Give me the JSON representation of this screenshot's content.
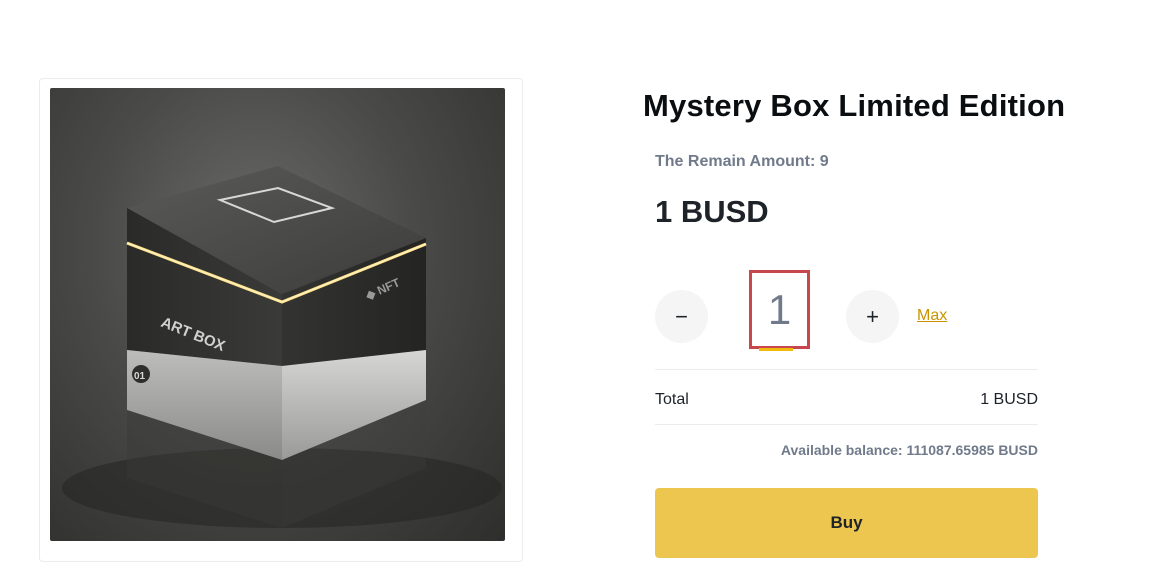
{
  "product": {
    "title": "Mystery Box Limited Edition",
    "remain_label": "The Remain Amount: 9",
    "price": "1 BUSD",
    "image_icon": "art-box-cube-image",
    "image_marks": {
      "brand": "ART BOX",
      "nft": "◆ NFT",
      "number": "01"
    }
  },
  "quantity": {
    "value": "1",
    "minus_symbol": "−",
    "plus_symbol": "+",
    "max_label": "Max"
  },
  "summary": {
    "total_label": "Total",
    "total_value": "1 BUSD",
    "balance_text": "Available balance: 111087.65985 BUSD"
  },
  "actions": {
    "buy_label": "Buy"
  },
  "colors": {
    "accent": "#f0b90b",
    "buy_button": "#ecc64e",
    "highlight_box": "#c8474e",
    "muted_text": "#707a8a"
  }
}
